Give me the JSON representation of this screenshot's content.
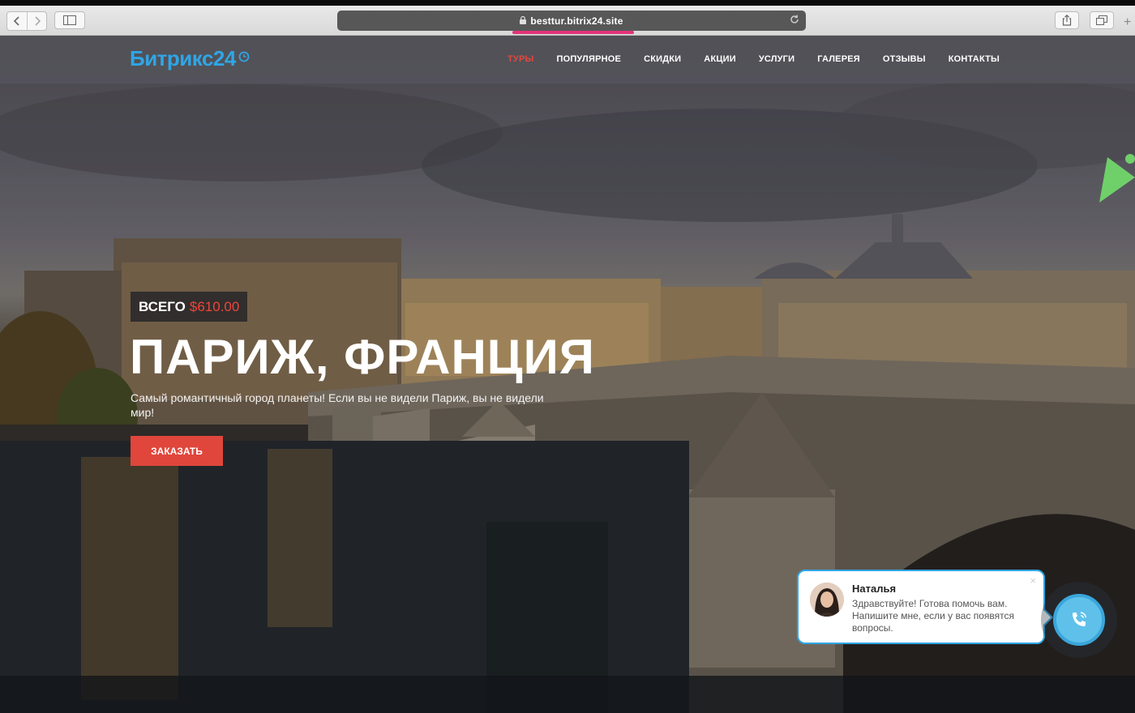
{
  "browser": {
    "url": "besttur.bitrix24.site",
    "plus": "+"
  },
  "site": {
    "logo": "Битрикс24",
    "menu": [
      {
        "label": "ТУРЫ",
        "active": true
      },
      {
        "label": "ПОПУЛЯРНОЕ",
        "active": false
      },
      {
        "label": "СКИДКИ",
        "active": false
      },
      {
        "label": "АКЦИИ",
        "active": false
      },
      {
        "label": "УСЛУГИ",
        "active": false
      },
      {
        "label": "ГАЛЕРЕЯ",
        "active": false
      },
      {
        "label": "ОТЗЫВЫ",
        "active": false
      },
      {
        "label": "КОНТАКТЫ",
        "active": false
      }
    ]
  },
  "hero": {
    "badge_label": "ВСЕГО",
    "badge_price": "$610.00",
    "title": "ПАРИЖ, ФРАНЦИЯ",
    "subtitle": "Самый романтичный город планеты! Если вы не видели Париж, вы не видели мир!",
    "order_button": "ЗАКАЗАТЬ"
  },
  "chat": {
    "name": "Наталья",
    "message": "Здравствуйте! Готова помочь вам. Напишите мне, если у вас появятся вопросы.",
    "close": "×"
  },
  "colors": {
    "accent": "#e0463b",
    "logo_blue": "#2fa6e6",
    "url_highlight": "#e4337a"
  }
}
